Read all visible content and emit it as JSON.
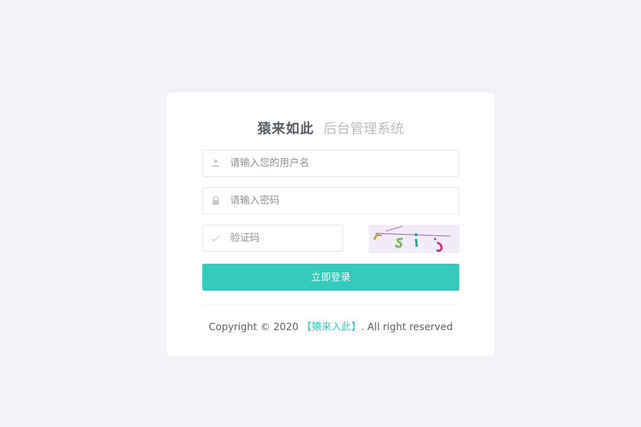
{
  "header": {
    "brand": "猿来如此",
    "subtitle": "后台管理系统"
  },
  "form": {
    "username_placeholder": "请输入您的用户名",
    "password_placeholder": "请输入密码",
    "captcha_placeholder": "验证码",
    "submit_label": "立即登录"
  },
  "footer": {
    "prefix": "Copyright © 2020 ",
    "brand_link": "【猿来入此】",
    "suffix": ". All right reserved"
  },
  "colors": {
    "accent": "#33c9bb",
    "background": "#f2f3f8"
  },
  "icons": {
    "username": "user-icon",
    "password": "lock-icon",
    "captcha": "check-icon"
  }
}
